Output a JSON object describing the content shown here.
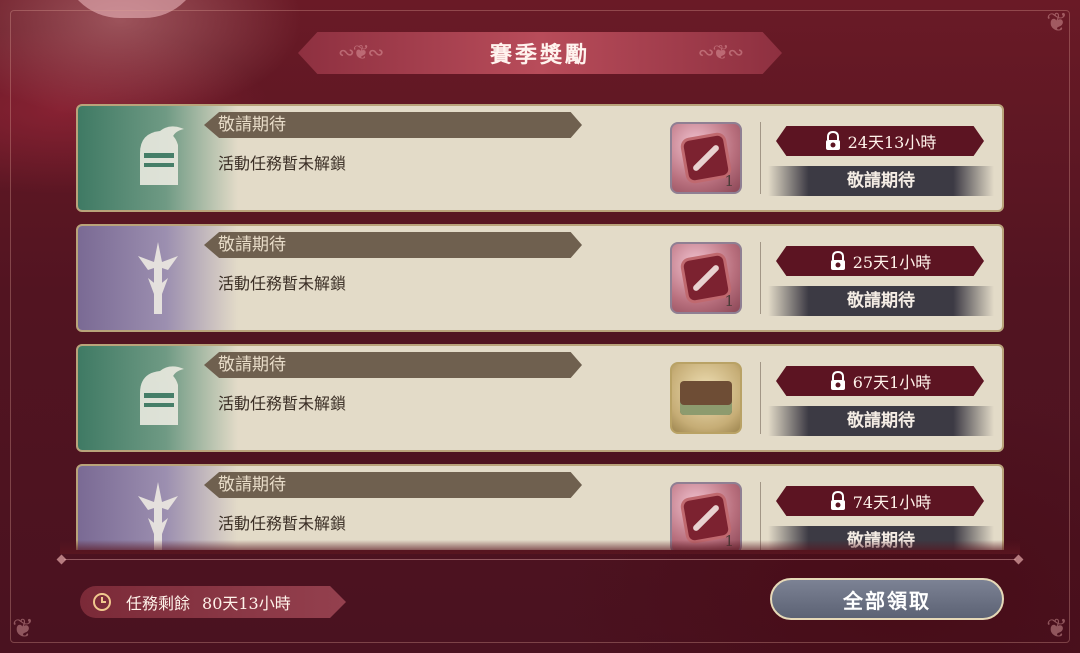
{
  "title": "賽季獎勵",
  "rewards": [
    {
      "label": "敬請期待",
      "desc": "活動任務暫未解鎖",
      "emblem": "knight-helmet-icon",
      "emblem_color": "#3f7a64",
      "item_icon": "red-scroll-item-icon",
      "item_count": "1",
      "lock_time": "24天13小時",
      "status": "敬請期待"
    },
    {
      "label": "敬請期待",
      "desc": "活動任務暫未解鎖",
      "emblem": "trident-icon",
      "emblem_color": "#7a6a94",
      "item_icon": "red-scroll-item-icon",
      "item_count": "1",
      "lock_time": "25天1小時",
      "status": "敬請期待"
    },
    {
      "label": "敬請期待",
      "desc": "活動任務暫未解鎖",
      "emblem": "knight-helmet-icon",
      "emblem_color": "#3f7a64",
      "item_icon": "bed-furniture-item-icon",
      "item_count": "",
      "lock_time": "67天1小時",
      "status": "敬請期待"
    },
    {
      "label": "敬請期待",
      "desc": "活動任務暫未解鎖",
      "emblem": "trident-icon",
      "emblem_color": "#7a6a94",
      "item_icon": "red-scroll-item-icon",
      "item_count": "1",
      "lock_time": "74天1小時",
      "status": "敬請期待"
    }
  ],
  "footer": {
    "remaining_label": "任務剩餘",
    "remaining_time": "80天13小時",
    "claim_all_label": "全部領取"
  },
  "colors": {
    "banner": "#b84c5a",
    "timer_bg": "#5c1422",
    "claim_bg": "#6a7082"
  }
}
